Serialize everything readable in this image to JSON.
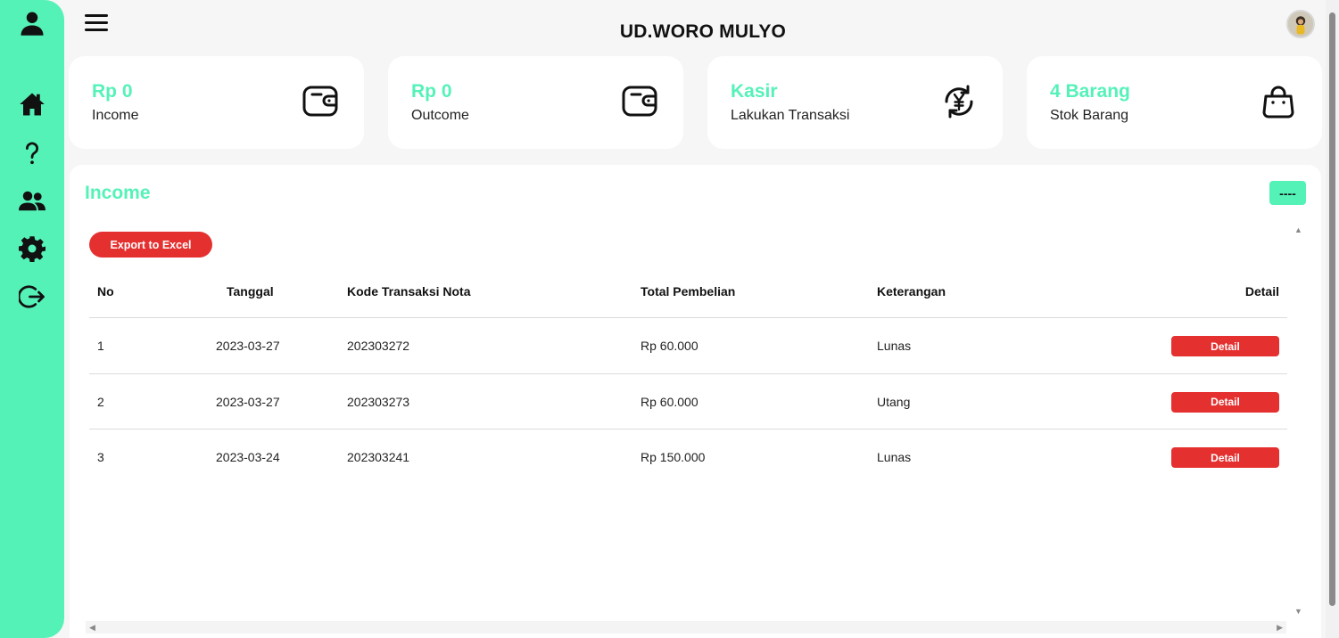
{
  "app": {
    "title": "UD.WORO MULYO"
  },
  "sidebar": {
    "items": [
      {
        "name": "profile",
        "icon": "user-icon"
      },
      {
        "name": "home",
        "icon": "home-icon"
      },
      {
        "name": "help",
        "icon": "help-icon"
      },
      {
        "name": "users",
        "icon": "users-icon"
      },
      {
        "name": "settings",
        "icon": "gear-icon"
      },
      {
        "name": "logout",
        "icon": "logout-icon"
      }
    ]
  },
  "cards": [
    {
      "value": "Rp 0",
      "label": "Income",
      "icon": "wallet-icon"
    },
    {
      "value": "Rp 0",
      "label": "Outcome",
      "icon": "wallet-icon"
    },
    {
      "value": "Kasir",
      "label": "Lakukan Transaksi",
      "icon": "exchange-yen-icon"
    },
    {
      "value": "4 Barang",
      "label": "Stok Barang",
      "icon": "shopping-bag-icon"
    }
  ],
  "panel": {
    "title": "Income",
    "toggle_label": "----",
    "export_label": "Export to Excel"
  },
  "table": {
    "headers": [
      "No",
      "Tanggal",
      "Kode Transaksi Nota",
      "Total Pembelian",
      "Keterangan",
      "Detail"
    ],
    "rows": [
      {
        "no": "1",
        "tanggal": "2023-03-27",
        "kode": "202303272",
        "total": "Rp 60.000",
        "keterangan": "Lunas",
        "detail": "Detail"
      },
      {
        "no": "2",
        "tanggal": "2023-03-27",
        "kode": "202303273",
        "total": "Rp 60.000",
        "keterangan": "Utang",
        "detail": "Detail"
      },
      {
        "no": "3",
        "tanggal": "2023-03-24",
        "kode": "202303241",
        "total": "Rp 150.000",
        "keterangan": "Lunas",
        "detail": "Detail"
      }
    ]
  },
  "colors": {
    "accent": "#55f2b8",
    "danger": "#e53030"
  }
}
